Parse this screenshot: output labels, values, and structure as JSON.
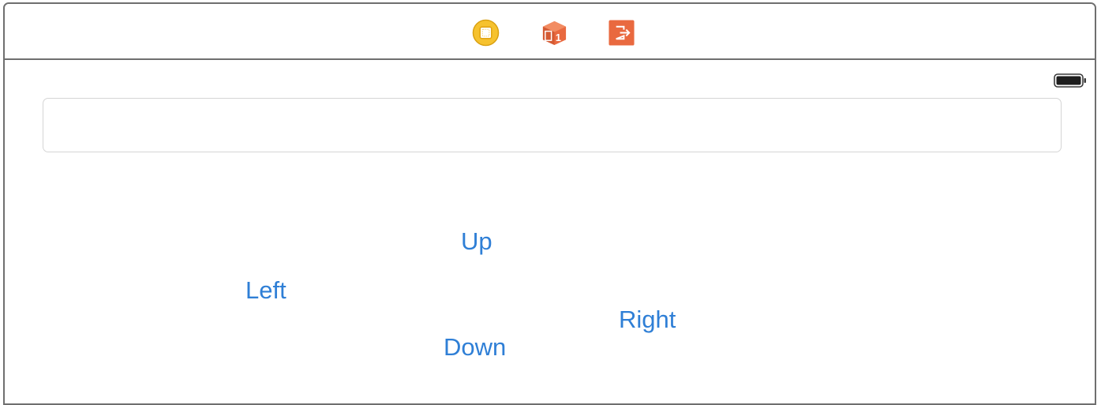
{
  "scene_dock": {
    "icons": [
      {
        "name": "view-controller-icon",
        "color": "#f0b323"
      },
      {
        "name": "first-responder-icon",
        "color": "#e9693f",
        "badge": "1"
      },
      {
        "name": "exit-icon",
        "color": "#e9693f"
      }
    ]
  },
  "status_bar": {
    "battery_icon": "battery-icon",
    "battery_level": 1.0
  },
  "text_field": {
    "value": "",
    "placeholder": ""
  },
  "buttons": {
    "up": "Up",
    "left": "Left",
    "right": "Right",
    "down": "Down"
  },
  "colors": {
    "button_tint": "#2f7fd6",
    "scene_border": "#6f6f6f",
    "field_border": "#d5d5d5"
  }
}
